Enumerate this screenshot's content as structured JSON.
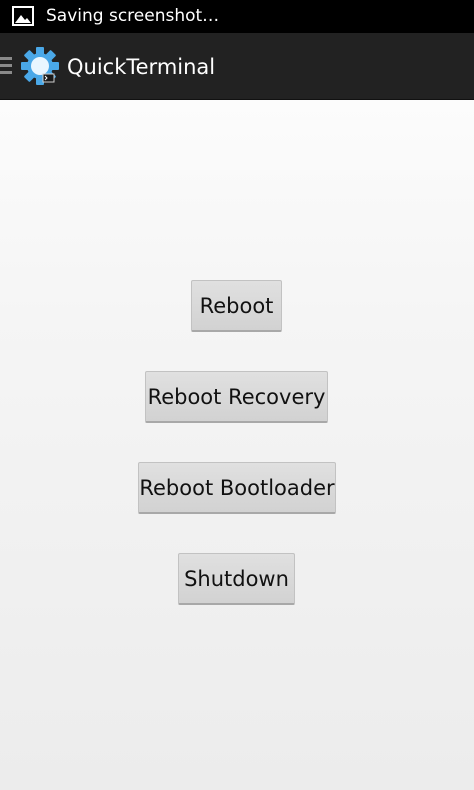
{
  "status_bar": {
    "notification_text": "Saving screenshot…",
    "notification_icon": "image-icon"
  },
  "action_bar": {
    "title": "QuickTerminal",
    "menu_icon": "drawer-menu-icon",
    "app_icon": "gear-icon",
    "background_color": "#222222"
  },
  "buttons": {
    "reboot": "Reboot",
    "reboot_recovery": "Reboot Recovery",
    "reboot_bootloader": "Reboot Bootloader",
    "shutdown": "Shutdown"
  }
}
